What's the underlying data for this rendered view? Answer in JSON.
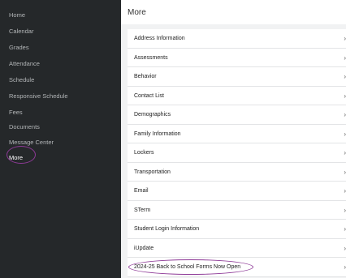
{
  "sidebar": {
    "items": [
      {
        "label": "Home"
      },
      {
        "label": "Calendar"
      },
      {
        "label": "Grades"
      },
      {
        "label": "Attendance"
      },
      {
        "label": "Schedule"
      },
      {
        "label": "Responsive Schedule"
      },
      {
        "label": "Fees"
      },
      {
        "label": "Documents"
      },
      {
        "label": "Message Center"
      },
      {
        "label": "More",
        "active": true
      }
    ]
  },
  "header": {
    "title": "More"
  },
  "more_list": {
    "items": [
      {
        "label": "Address Information"
      },
      {
        "label": "Assessments"
      },
      {
        "label": "Behavior"
      },
      {
        "label": "Contact List"
      },
      {
        "label": "Demographics"
      },
      {
        "label": "Family Information"
      },
      {
        "label": "Lockers"
      },
      {
        "label": "Transportation"
      },
      {
        "label": "Email"
      },
      {
        "label": "STerm"
      },
      {
        "label": "Student Login Information"
      },
      {
        "label": "iUpdate"
      },
      {
        "label": "2024-25 Back to School Forms Now Open",
        "highlighted": true
      }
    ],
    "chevron": "›"
  },
  "colors": {
    "sidebar_bg": "#25282a",
    "highlight_circle": "#8e3a97",
    "content_bg": "#f1f2f3"
  }
}
